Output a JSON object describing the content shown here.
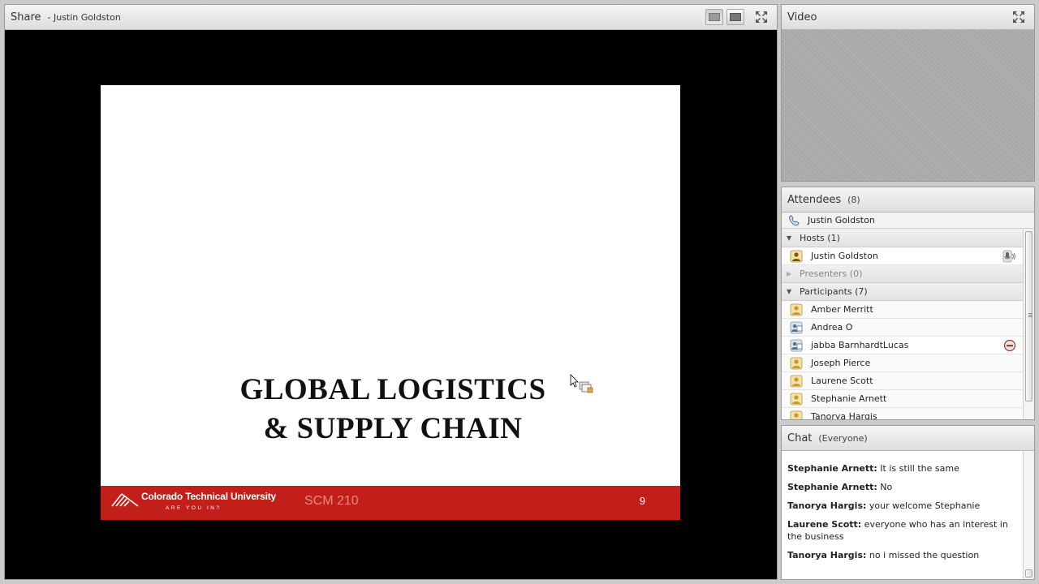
{
  "share_pod": {
    "title": "Share",
    "presenter": "- Justin Goldston"
  },
  "slide": {
    "title_line1": "GLOBAL LOGISTICS",
    "title_line2": "& SUPPLY CHAIN",
    "footer": {
      "brand": "Colorado Technical University",
      "tagline": "ARE YOU IN?",
      "course": "SCM 210",
      "page": "9"
    }
  },
  "video_pod": {
    "title": "Video"
  },
  "attendees_pod": {
    "title": "Attendees",
    "count": "(8)",
    "self_name": "Justin Goldston",
    "groups": {
      "hosts_label": "Hosts (1)",
      "presenters_label": "Presenters (0)",
      "participants_label": "Participants (7)"
    },
    "hosts": [
      "Justin Goldston"
    ],
    "participants": [
      "Amber Merritt",
      "Andrea O",
      "jabba BarnhardtLucas",
      "Joseph Pierce",
      "Laurene Scott",
      "Stephanie Arnett",
      "Tanorya Hargis"
    ]
  },
  "chat_pod": {
    "title": "Chat",
    "scope": "(Everyone)",
    "messages": [
      {
        "who": "Stephanie Arnett:",
        "text": " It is still the same"
      },
      {
        "who": "Stephanie Arnett:",
        "text": " No"
      },
      {
        "who": "Tanorya Hargis:",
        "text": " your welcome Stephanie"
      },
      {
        "who": "Laurene Scott:",
        "text": " everyone who has an interest in the business"
      },
      {
        "who": "Tanorya Hargis:",
        "text": " no i missed the question"
      }
    ]
  },
  "colors": {
    "slide_footer": "#c21f1a",
    "pod_header": "#e6e6e6",
    "share_background": "#000000"
  },
  "icons": {
    "layout_left": "screen-layout-icon",
    "layout_right": "screen-layout-icon",
    "fullscreen": "fullscreen-icon",
    "phone": "phone-icon",
    "user": "user-icon",
    "microphone": "microphone-icon",
    "status_away": "status-away-icon"
  }
}
